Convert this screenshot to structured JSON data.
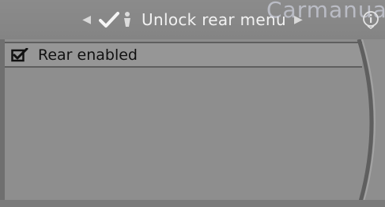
{
  "header": {
    "title": "Unlock rear menu",
    "prev_icon": "chevron-left-icon",
    "next_icon": "chevron-right-icon",
    "status_icon": "check-person-icon",
    "info_icon": "info-icon"
  },
  "watermark": "Carmanuals",
  "menu": {
    "items": [
      {
        "label": "Rear enabled",
        "checked": true,
        "icon": "checkbox-checked-icon"
      }
    ]
  },
  "colors": {
    "background": "#8a8a8a",
    "title_text": "#f2f2f2",
    "item_text": "#111111"
  }
}
